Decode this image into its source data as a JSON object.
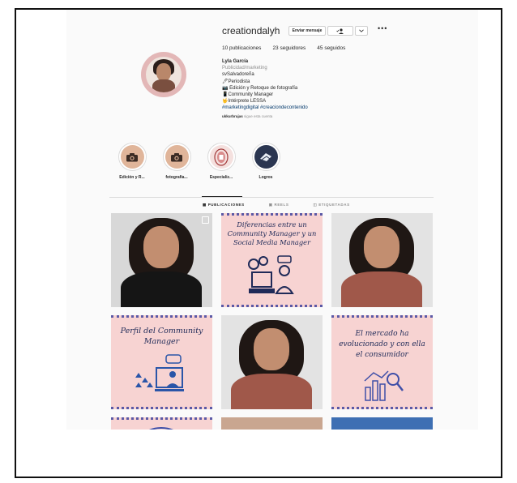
{
  "profile": {
    "username": "creationdalyh",
    "buttons": {
      "message": "Enviar mensaje",
      "follow_icon": "person-check-icon",
      "dropdown_icon": "chevron-down-icon",
      "more": "•••"
    },
    "stats": {
      "posts": "10 publicaciones",
      "followers": "23 seguidores",
      "following": "45 seguidos"
    },
    "bio": {
      "name": "Lyla García",
      "category": "Publicidad/marketing",
      "lines": [
        "svSalvadoreña",
        "🖊Periodista",
        "📷 Edición y Retoque de fotografía",
        "📱Community Manager",
        "🤟Intérprete LESSA"
      ],
      "hashtags": "#marketingdigital #creaciondecontenido",
      "followed_by_user": "ukkurbrujas",
      "followed_by_text": " sigue esta cuenta"
    }
  },
  "highlights": [
    {
      "label": "Edición y R...",
      "icon": "camera-icon",
      "color": "#e0b59a"
    },
    {
      "label": "fotografía...",
      "icon": "camera-icon",
      "color": "#e0b59a"
    },
    {
      "label": "Especializ...",
      "icon": "seal-icon",
      "color": "#f4e0de"
    },
    {
      "label": "Logros",
      "icon": "trophy-icon",
      "color": "#2a3550"
    }
  ],
  "tabs": [
    {
      "label": "PUBLICACIONES",
      "icon": "grid-icon",
      "active": true
    },
    {
      "label": "REELS",
      "icon": "reels-icon",
      "active": false
    },
    {
      "label": "ETIQUETADAS",
      "icon": "tag-icon",
      "active": false
    }
  ],
  "posts": {
    "p2_title": "Diferencias entre un Community Manager y un Social Media Manager",
    "p4_title": "Perfil del Community Manager",
    "p6_title": "El mercado ha evolucionado y con ella el consumidor"
  }
}
